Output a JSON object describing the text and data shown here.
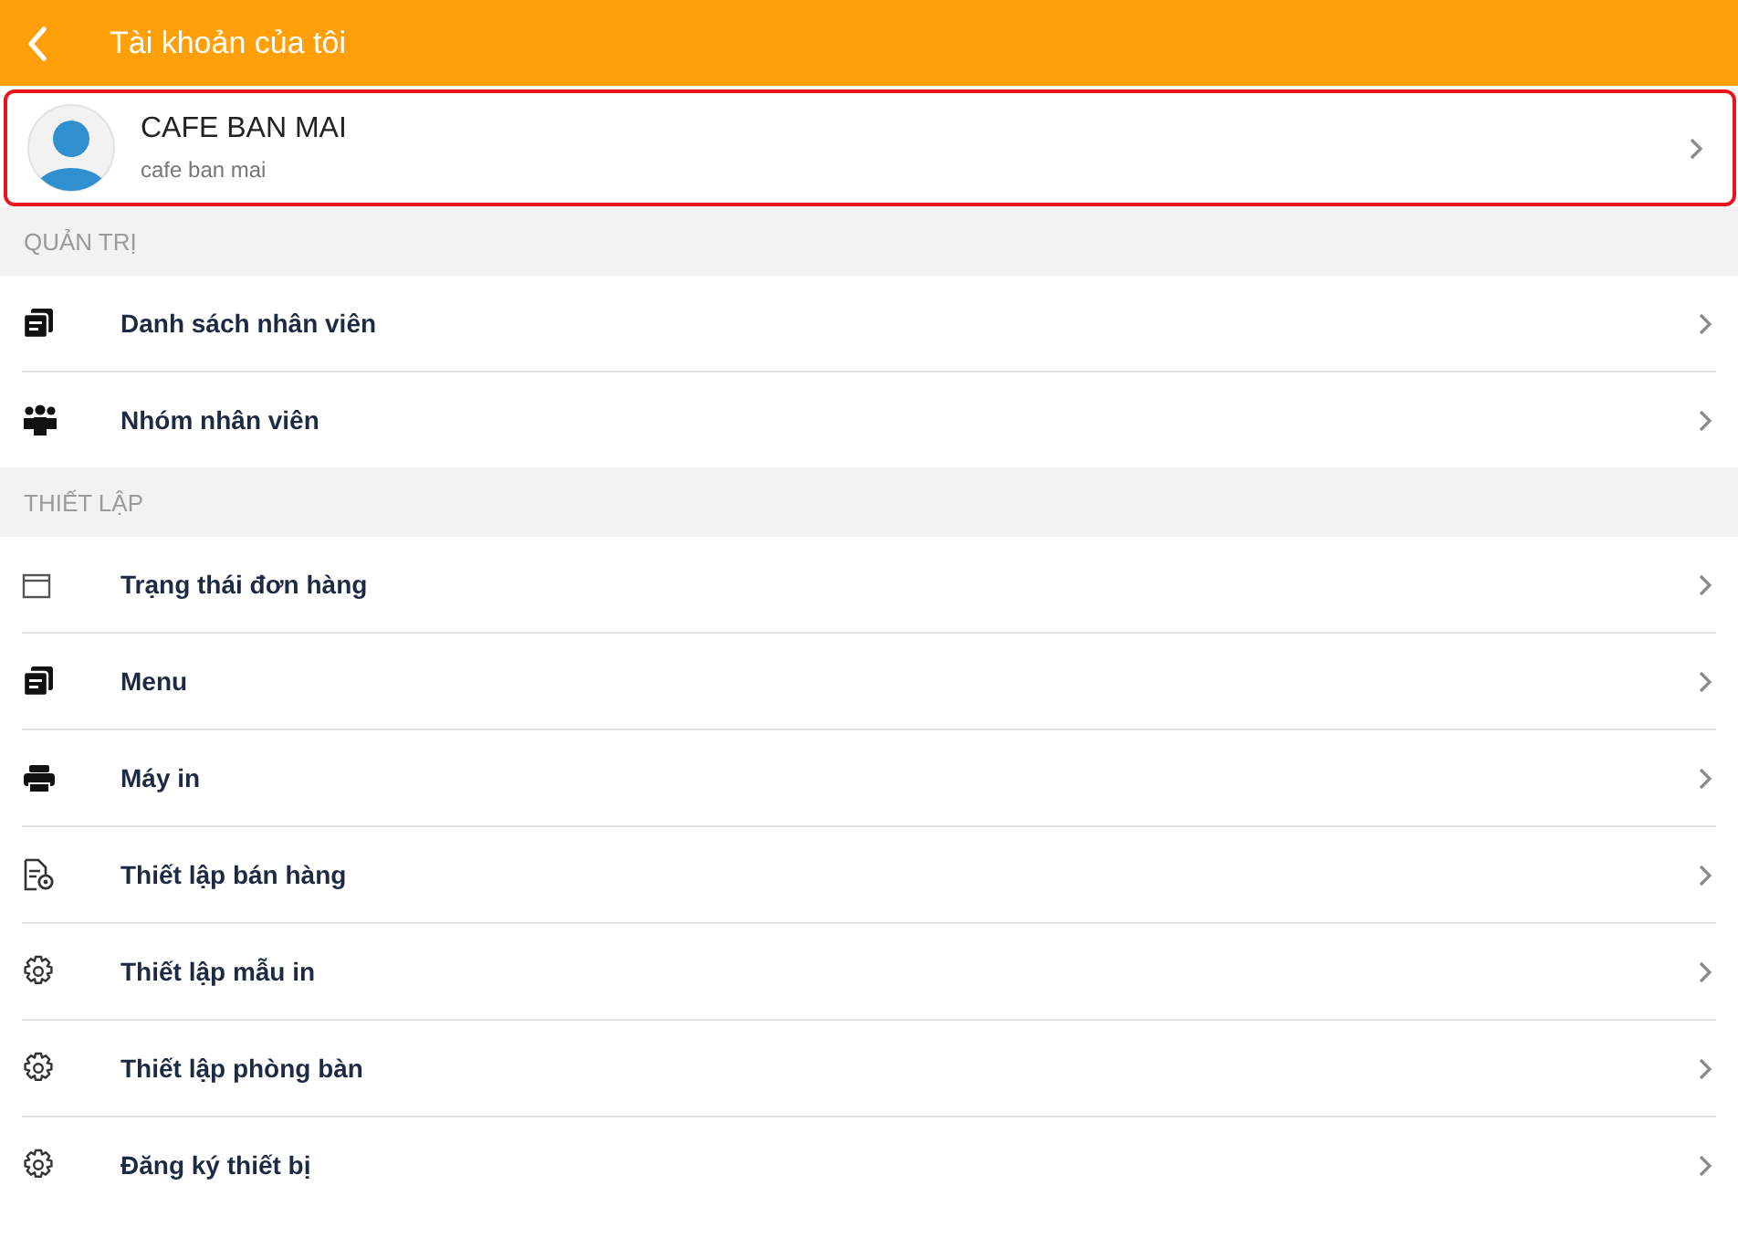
{
  "header": {
    "title": "Tài khoản của tôi"
  },
  "profile": {
    "name": "CAFE BAN MAI",
    "subtitle": "cafe ban mai",
    "highlighted": true
  },
  "sections": [
    {
      "title": "QUẢN TRỊ",
      "items": [
        {
          "label": "Danh sách nhân viên",
          "kind": "documents"
        },
        {
          "label": "Nhóm nhân viên",
          "kind": "group"
        }
      ]
    },
    {
      "title": "THIẾT LẬP",
      "items": [
        {
          "label": "Trạng thái đơn hàng",
          "kind": "window"
        },
        {
          "label": "Menu",
          "kind": "documents"
        },
        {
          "label": "Máy in",
          "kind": "printer"
        },
        {
          "label": "Thiết lập bán hàng",
          "kind": "filegear"
        },
        {
          "label": "Thiết lập mẫu in",
          "kind": "gear"
        },
        {
          "label": "Thiết lập phòng bàn",
          "kind": "gear"
        },
        {
          "label": "Đăng ký thiết bị",
          "kind": "gear"
        }
      ]
    }
  ]
}
